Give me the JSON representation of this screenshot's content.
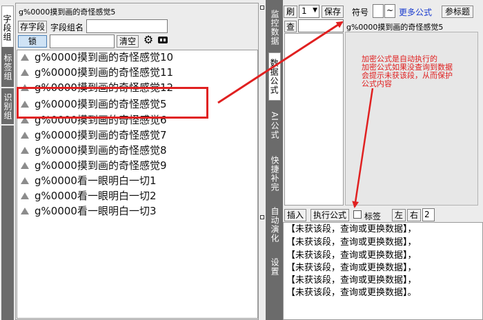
{
  "left_tabs": [
    "字段组",
    "标签组",
    "识别组"
  ],
  "middle_tabs": [
    "监控数据",
    "数据公式",
    "AI公式",
    "快捷补完",
    "自动演化",
    "设置"
  ],
  "field_panel": {
    "title": "g%0000摸到画的奇怪感觉5",
    "save_field_btn": "存字段",
    "field_group_label": "字段组名",
    "lock_btn": "锁",
    "clear_btn": "清空",
    "items": [
      "g%0000摸到画的奇怪感觉10",
      "g%0000摸到画的奇怪感觉11",
      "g%0000摸到画的奇怪感觉12",
      "g%0000摸到画的奇怪感觉5",
      "g%0000摸到画的奇怪感觉6",
      "g%0000摸到画的奇怪感觉7",
      "g%0000摸到画的奇怪感觉8",
      "g%0000摸到画的奇怪感觉9",
      "g%0000看一眼明白一切1",
      "g%0000看一眼明白一切2",
      "g%0000看一眼明白一切3"
    ],
    "selected_index": 3
  },
  "right_panel": {
    "refresh_btn": "刷",
    "count_select": "1",
    "save_btn": "保存",
    "symbol_label": "符号",
    "symbol_value": "~",
    "more_formula_link": "更多公式",
    "param_btn": "参标题",
    "lookup_btn": "查",
    "formula_title": "g%0000摸到画的奇怪感觉5",
    "annotation": "加密公式是自动执行的\n加密公式如果没查询到数据\n会提示未获该段，从而保护\n公式内容",
    "insert_btn": "插入",
    "execute_btn": "执行公式",
    "tag_label": "标签",
    "left_btn": "左",
    "right_btn": "右",
    "right_value": "2",
    "output_lines": [
      "【未获该段，查询或更换数据】，",
      "【未获该段，查询或更换数据】，",
      "【未获该段，查询或更换数据】，",
      "【未获该段，查询或更换数据】，",
      "【未获该段，查询或更换数据】，",
      "【未获该段，查询或更换数据】。"
    ]
  },
  "colors": {
    "highlight_box": "#e02020",
    "arrow": "#e02020",
    "annotation_text": "#e02020",
    "link": "#1a3ccf",
    "lock_button": "#cfe3f5"
  },
  "icons": [
    "gear-icon",
    "keyboard-icon",
    "file-icon"
  ]
}
